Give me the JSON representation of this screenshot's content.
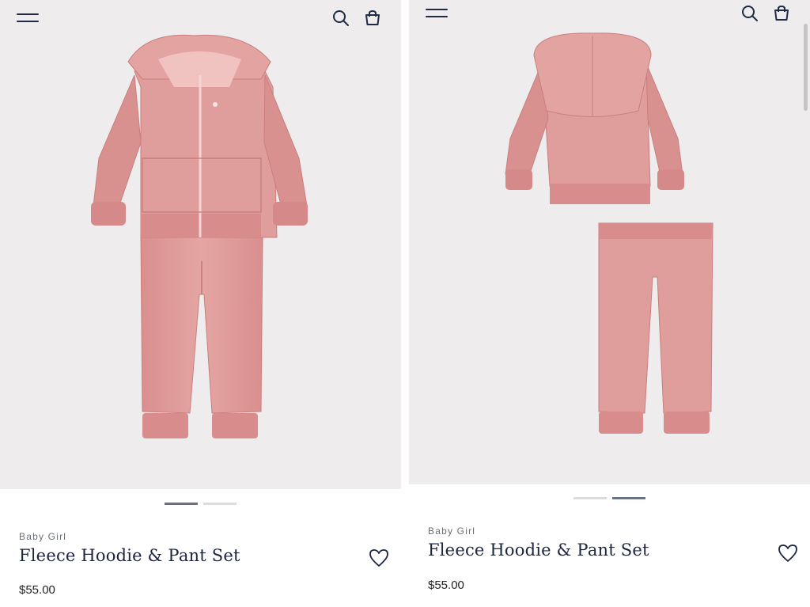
{
  "colors": {
    "image_bg": "#eeeced",
    "garment_pink": "#dc9a98",
    "navy": "#1b2540",
    "indicator_active": "#6b7287",
    "indicator_inactive": "#dcdcdc"
  },
  "icons": {
    "menu": "hamburger-menu-icon",
    "search": "search-icon",
    "bag": "shopping-bag-icon",
    "wishlist": "heart-icon"
  },
  "screens": [
    {
      "image_alt": "Pink fleece zip hoodie and jogger pants, front view",
      "carousel": {
        "total": 2,
        "active": 1
      },
      "product": {
        "category": "Baby Girl",
        "title": "Fleece Hoodie & Pant Set",
        "price": "$55.00"
      }
    },
    {
      "image_alt": "Pink fleece hoodie and jogger pants, back view",
      "carousel": {
        "total": 2,
        "active": 2
      },
      "product": {
        "category": "Baby Girl",
        "title": "Fleece Hoodie & Pant Set",
        "price": "$55.00"
      }
    }
  ]
}
